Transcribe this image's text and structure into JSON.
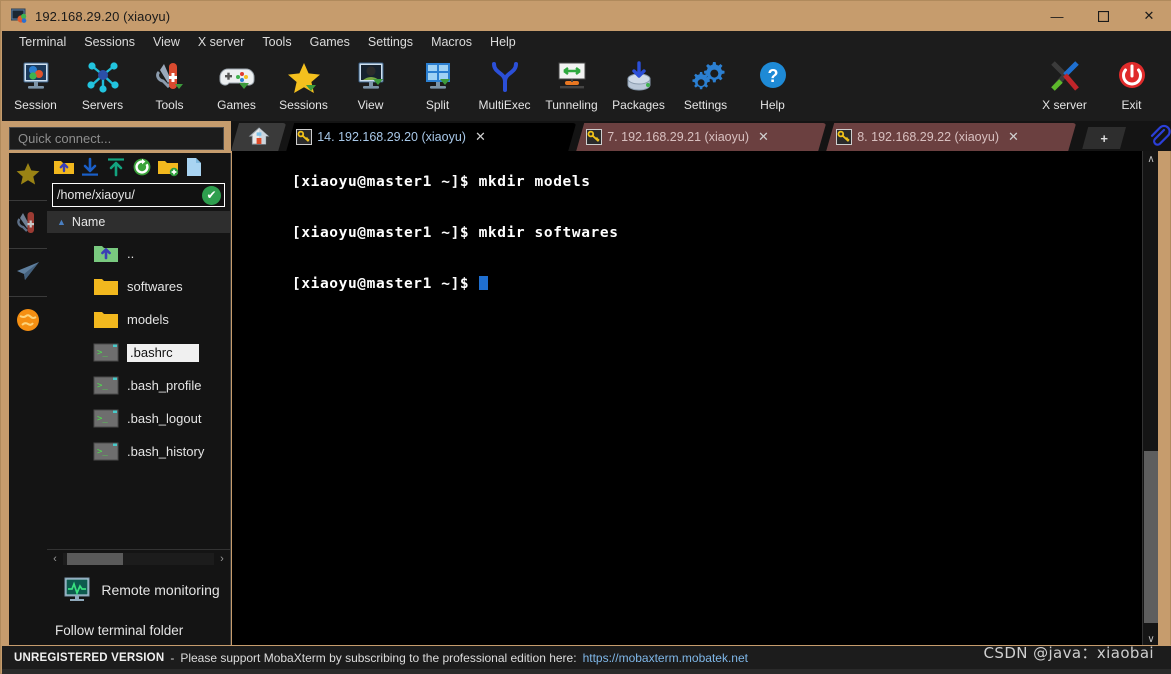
{
  "window": {
    "title": "192.168.29.20 (xiaoyu)",
    "title_icon": "mobaxterm-icon",
    "minimize": "—",
    "maximize": "☐",
    "close": "✕",
    "titlebar_color": "#c69c6d"
  },
  "menubar": {
    "items": [
      {
        "label": "Terminal"
      },
      {
        "label": "Sessions"
      },
      {
        "label": "View"
      },
      {
        "label": "X server"
      },
      {
        "label": "Tools"
      },
      {
        "label": "Games"
      },
      {
        "label": "Settings"
      },
      {
        "label": "Macros"
      },
      {
        "label": "Help"
      }
    ]
  },
  "toolbar": {
    "buttons": [
      {
        "label": "Session",
        "icon": "session-icon"
      },
      {
        "label": "Servers",
        "icon": "servers-icon"
      },
      {
        "label": "Tools",
        "icon": "tools-icon"
      },
      {
        "label": "Games",
        "icon": "games-icon"
      },
      {
        "label": "Sessions",
        "icon": "sessions-star-icon"
      },
      {
        "label": "View",
        "icon": "view-icon"
      },
      {
        "label": "Split",
        "icon": "split-icon"
      },
      {
        "label": "MultiExec",
        "icon": "multiexec-icon"
      },
      {
        "label": "Tunneling",
        "icon": "tunneling-icon"
      },
      {
        "label": "Packages",
        "icon": "packages-icon"
      },
      {
        "label": "Settings",
        "icon": "settings-gear-icon"
      },
      {
        "label": "Help",
        "icon": "help-question-icon"
      }
    ],
    "right_buttons": [
      {
        "label": "X server",
        "icon": "x-server-icon"
      },
      {
        "label": "Exit",
        "icon": "exit-power-icon"
      }
    ]
  },
  "quick_connect": {
    "placeholder": "Quick connect..."
  },
  "tabs": {
    "home_icon": "home-icon",
    "items": [
      {
        "label": "14. 192.168.29.20 (xiaoyu)",
        "active": true,
        "icon": "key-icon",
        "close": "✕"
      },
      {
        "label": "7. 192.168.29.21 (xiaoyu)",
        "active": false,
        "icon": "key-icon",
        "close": "✕"
      },
      {
        "label": "8. 192.168.29.22 (xiaoyu)",
        "active": false,
        "icon": "key-icon",
        "close": "✕"
      }
    ],
    "add_label": "+",
    "attach_icon": "paperclip-icon"
  },
  "rail": {
    "items": [
      {
        "icon": "star-bookmarks-icon"
      },
      {
        "icon": "swiss-knife-tools-icon"
      },
      {
        "icon": "paper-plane-send-icon"
      },
      {
        "icon": "globe-world-icon"
      }
    ]
  },
  "sidebar": {
    "toolbar_icons": [
      {
        "icon": "folder-up-icon"
      },
      {
        "icon": "download-icon"
      },
      {
        "icon": "upload-icon"
      },
      {
        "icon": "refresh-icon"
      },
      {
        "icon": "new-folder-icon"
      },
      {
        "icon": "new-file-icon"
      }
    ],
    "path": "/home/xiaoyu/",
    "path_ok_mark": "✔",
    "column_header": "Name",
    "sort_arrow": "▲",
    "files": [
      {
        "name": "..",
        "type": "parent-folder",
        "selected": false
      },
      {
        "name": "softwares",
        "type": "folder",
        "selected": false
      },
      {
        "name": "models",
        "type": "folder",
        "selected": false
      },
      {
        "name": ".bashrc",
        "type": "script-file",
        "selected": true
      },
      {
        "name": ".bash_profile",
        "type": "script-file",
        "selected": false
      },
      {
        "name": ".bash_logout",
        "type": "script-file",
        "selected": false
      },
      {
        "name": ".bash_history",
        "type": "script-file",
        "selected": false
      }
    ],
    "hscroll_left": "‹",
    "hscroll_right": "›",
    "remote_monitoring_label": "Remote monitoring",
    "remote_monitoring_icon": "monitor-graph-icon",
    "follow_terminal_folder": "Follow terminal folder"
  },
  "terminal": {
    "lines": [
      {
        "prompt": "[xiaoyu@master1 ~]$",
        "command": " mkdir models"
      },
      {
        "prompt": "[xiaoyu@master1 ~]$",
        "command": " mkdir softwares"
      },
      {
        "prompt": "[xiaoyu@master1 ~]$",
        "command": "",
        "cursor": true
      }
    ],
    "cursor_color": "#1f6fd0"
  },
  "scrollbar": {
    "up_arrow": "∧",
    "down_arrow": "∨"
  },
  "statusbar": {
    "unregistered": "UNREGISTERED VERSION",
    "dash": "-",
    "message": "Please support MobaXterm by subscribing to the professional edition here:",
    "url": "https://mobaxterm.mobatek.net"
  },
  "watermark": {
    "text": "CSDN @java：xiaobai"
  }
}
